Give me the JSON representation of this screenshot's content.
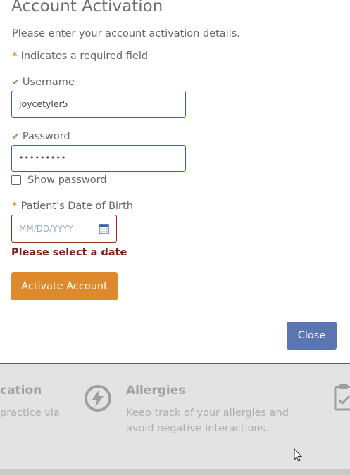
{
  "modal": {
    "title": "Account Activation",
    "intro": "Please enter your account activation details.",
    "required_note": "Indicates a required field",
    "required_marker": "*",
    "username": {
      "label": "Username",
      "value": "joycetyler5"
    },
    "password": {
      "label": "Password",
      "value": "•••••••••"
    },
    "show_password": {
      "label": "Show password",
      "checked": false
    },
    "dob": {
      "label": "Patient's Date of Birth",
      "placeholder": "MM/DD/YYYY",
      "icon": "calendar-icon"
    },
    "error": "Please select a date",
    "activate_label": "Activate Account",
    "close_label": "Close"
  },
  "background": {
    "left_title": "cation",
    "left_desc": "practice via",
    "allergies_title": "Allergies",
    "allergies_desc_line1": "Keep track of your allergies and",
    "allergies_desc_line2": "avoid negative interactions.",
    "allergies_icon": "lightning-bolt-icon",
    "right_icon": "clipboard-check-icon"
  },
  "colors": {
    "accent_orange": "#de8a2c",
    "primary_blue": "#5a75b0",
    "error_red": "#7b1d12",
    "valid_green": "#6aa84f"
  }
}
